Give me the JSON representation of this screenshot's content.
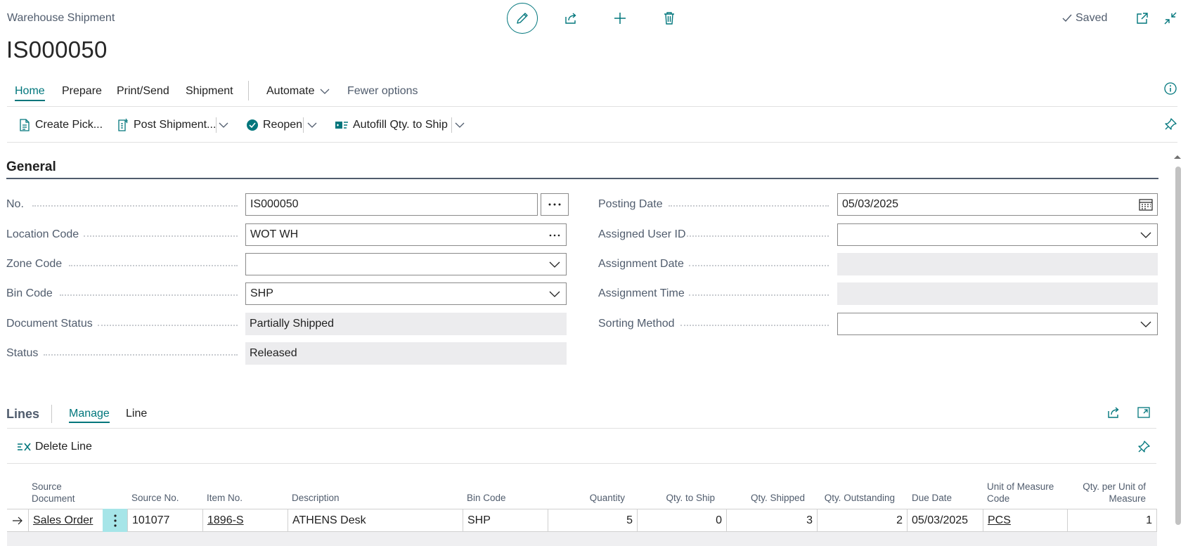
{
  "header": {
    "caption": "Warehouse Shipment",
    "title": "IS000050",
    "saved_label": "Saved"
  },
  "action_tabs": {
    "home": "Home",
    "prepare": "Prepare",
    "print_send": "Print/Send",
    "shipment": "Shipment",
    "automate": "Automate",
    "fewer_options": "Fewer options"
  },
  "ribbon": {
    "create_pick": "Create Pick...",
    "post_shipment": "Post Shipment...",
    "reopen": "Reopen",
    "autofill": "Autofill Qty. to Ship"
  },
  "general": {
    "title": "General",
    "fields": {
      "no": {
        "label": "No.",
        "value": "IS000050"
      },
      "location_code": {
        "label": "Location Code",
        "value": "WOT WH"
      },
      "zone_code": {
        "label": "Zone Code",
        "value": ""
      },
      "bin_code": {
        "label": "Bin Code",
        "value": "SHP"
      },
      "document_status": {
        "label": "Document Status",
        "value": "Partially Shipped"
      },
      "status": {
        "label": "Status",
        "value": "Released"
      },
      "posting_date": {
        "label": "Posting Date",
        "value": "05/03/2025"
      },
      "assigned_user_id": {
        "label": "Assigned User ID",
        "value": ""
      },
      "assignment_date": {
        "label": "Assignment Date",
        "value": ""
      },
      "assignment_time": {
        "label": "Assignment Time",
        "value": ""
      },
      "sorting_method": {
        "label": "Sorting Method",
        "value": ""
      }
    }
  },
  "lines": {
    "title": "Lines",
    "tabs": {
      "manage": "Manage",
      "line": "Line"
    },
    "delete_line": "Delete Line",
    "columns": {
      "source_document_1": "Source",
      "source_document_2": "Document",
      "source_no": "Source No.",
      "item_no": "Item No.",
      "description": "Description",
      "bin_code": "Bin Code",
      "quantity": "Quantity",
      "qty_to_ship": "Qty. to Ship",
      "qty_shipped": "Qty. Shipped",
      "qty_outstanding": "Qty. Outstanding",
      "due_date": "Due Date",
      "uom_1": "Unit of Measure",
      "uom_2": "Code",
      "qty_per_uom_1": "Qty. per Unit of",
      "qty_per_uom_2": "Measure"
    },
    "rows": [
      {
        "source_document": "Sales Order",
        "source_no": "101077",
        "item_no": "1896-S",
        "description": "ATHENS Desk",
        "bin_code": "SHP",
        "quantity": "5",
        "qty_to_ship": "0",
        "qty_shipped": "3",
        "qty_outstanding": "2",
        "due_date": "05/03/2025",
        "uom": "PCS",
        "qty_per_uom": "1"
      }
    ]
  },
  "colors": {
    "accent": "#00767c",
    "label": "#505c6d",
    "readonly_bg": "#ececee"
  }
}
